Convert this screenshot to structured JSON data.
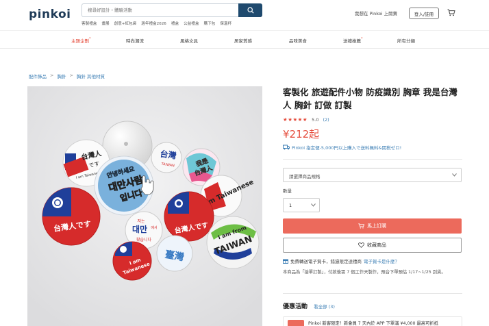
{
  "header": {
    "logo": "pinkoi",
    "search_placeholder": "搜尋好設計・體驗活動",
    "hot_keywords": [
      "客製禮盒",
      "畫展",
      "創意+紅包袋",
      "過年禮盒2026",
      "禮盒",
      "公益禮盒",
      "購下包",
      "保溫杯"
    ],
    "seller_link": "我想在 Pinkoi 上開賣",
    "login_label": "登入/註冊"
  },
  "nav": {
    "items": [
      {
        "label": "主題企劃",
        "star": "*",
        "active": true
      },
      {
        "label": "時尚潮流",
        "star": "",
        "active": false
      },
      {
        "label": "風格文具",
        "star": "",
        "active": false
      },
      {
        "label": "居家質感",
        "star": "",
        "active": false
      },
      {
        "label": "品味美食",
        "star": "",
        "active": false
      },
      {
        "label": "送禮推薦",
        "star": "*",
        "active": false
      },
      {
        "label": "所有分類",
        "star": "",
        "active": false
      }
    ]
  },
  "breadcrumb": [
    "配件飾品",
    "胸針",
    "胸針 其他材質"
  ],
  "product": {
    "title": "客製化 旅遊配件小物 防疫識別 胸章 我是台灣人 胸針 訂做 訂製",
    "stars": "★★★★★",
    "rating": "5.0",
    "review_count": "(2)",
    "price": "¥212起",
    "promo_line": "Pinkoi 指定便-5,000円以上購入で送料無料&関税ゼロ!",
    "spec_placeholder": "請選擇商品規格",
    "qty_label": "數量",
    "qty_value": "1",
    "buy_label": "馬上訂購",
    "fav_label": "收藏商品",
    "gift_text": "免費轉送電子賀卡，錯過限定送禮商",
    "gift_link": "電子賀卡是什麼？",
    "ship_note": "本商品為「接單訂製」，付款後需 7 個工作天製作，預台下單預估 1/17~1/25 到貨。",
    "promo_title": "優惠活動",
    "promo_see_all": "看全部 (3)",
    "promo_card_text": "Pinkoi 新客限定！新會員 7 天內於 APP 下單滿 ¥4,000 最高可折抵"
  },
  "image_badges": {
    "b1": [
      "台灣人",
      "です",
      "I am Taiwanese"
    ],
    "b2": [
      "안녕하세요",
      "대만사람",
      "입니다"
    ],
    "b3": [
      "台灣人です"
    ],
    "b4": [
      "저는",
      "대만",
      "에서",
      "왔습니다"
    ],
    "b5": [
      "台灣人です"
    ],
    "b6": [
      "I am from",
      "TAIWAN"
    ],
    "b7": [
      "I am",
      "Taiwanese"
    ],
    "b8": [
      "台灣",
      "TAIWAN"
    ],
    "b9": [
      "我是",
      "台灣人"
    ],
    "b10": [
      "I am Taiwanese"
    ],
    "b11": [
      "臺灣"
    ]
  },
  "colors": {
    "accent": "#e54c3c",
    "link": "#3d7fb5",
    "brand_navy": "#1f3b57",
    "buy_button": "#ec6a5c"
  }
}
